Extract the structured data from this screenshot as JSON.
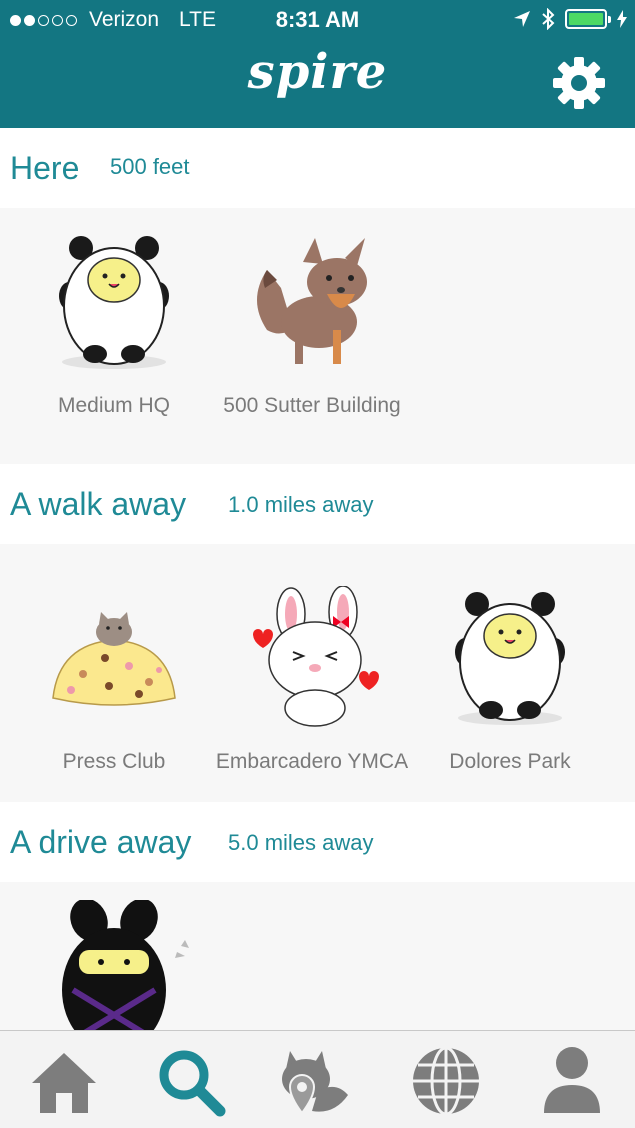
{
  "status_bar": {
    "carrier": "Verizon",
    "network": "LTE",
    "time": "8:31 AM"
  },
  "nav": {
    "logo_text": "spire"
  },
  "sections": [
    {
      "title": "Here",
      "distance": "500 feet",
      "places": [
        {
          "name": "Medium HQ",
          "icon": "panda-cat-icon"
        },
        {
          "name": "500 Sutter Building",
          "icon": "fox-icon"
        }
      ]
    },
    {
      "title": "A walk away",
      "distance": "1.0 miles away",
      "places": [
        {
          "name": "Press Club",
          "icon": "cat-on-cookie-pile-icon"
        },
        {
          "name": "Embarcadero YMCA",
          "icon": "bunny-icon"
        },
        {
          "name": "Dolores Park",
          "icon": "panda-cat-icon"
        }
      ]
    },
    {
      "title": "A drive away",
      "distance": "5.0 miles away",
      "places": [
        {
          "name": "",
          "icon": "ninja-bunny-icon"
        }
      ]
    }
  ],
  "colors": {
    "header": "#137682",
    "accent": "#1f8a96",
    "battery": "#4cd964"
  },
  "tabbar": [
    {
      "icon": "home-icon",
      "active": false
    },
    {
      "icon": "search-icon",
      "active": true
    },
    {
      "icon": "fox-pin-icon",
      "active": false
    },
    {
      "icon": "globe-icon",
      "active": false
    },
    {
      "icon": "person-icon",
      "active": false
    }
  ]
}
